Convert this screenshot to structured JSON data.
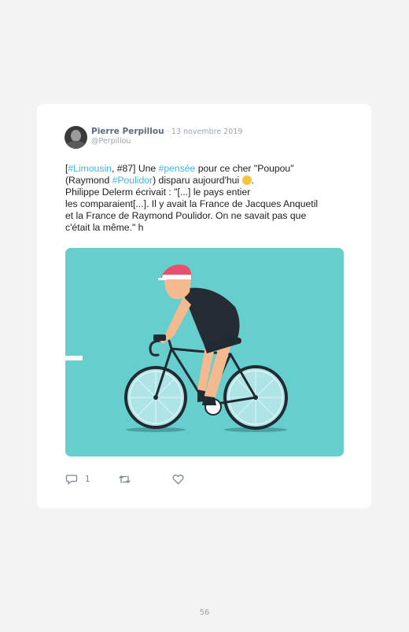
{
  "tweet": {
    "author_name": "Pierre Perpillou",
    "date": "· 13 novembre 2019",
    "handle": "@Perpillou",
    "text": {
      "l1_a": "[",
      "l1_tag1": "#Limousin",
      "l1_b": ", #87] Une ",
      "l1_tag2": "#pensée",
      "l1_c": " pour ce cher \"Poupou\"",
      "l2_a": "(Raymond ",
      "l2_tag": "#Poulidor",
      "l2_b": ") disparu aujourd'hui ",
      "l2_c": ".",
      "l3": "Philippe Delerm écrivait : \"[...] le pays entier",
      "l4": "les comparaient[...]. Il y avait la France de Jacques Anquetil",
      "l5": "et la France de Raymond Poulidor. On ne savait pas que",
      "l6": "c'était la même.\" h"
    },
    "emoji_icon": "crying-face-emoji",
    "media_illustration": "cyclist-on-road-bike",
    "actions": {
      "reply_count": "1",
      "retweet_count": "",
      "like_count": ""
    }
  },
  "page_number": "56"
}
